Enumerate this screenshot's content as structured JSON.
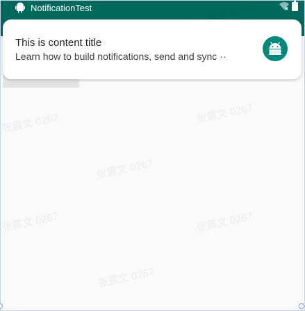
{
  "status_bar": {
    "app_label": "NotificationTest",
    "app_icon": "android-icon",
    "wifi_icon": "wifi-x-icon",
    "battery_icon": "battery-icon"
  },
  "notification": {
    "title": "This is content title",
    "text": "Learn how to build notifications, send and sync",
    "overflow_marker": "··",
    "large_icon": "android-robot-icon"
  },
  "watermark": {
    "text": "张震文 0267"
  },
  "colors": {
    "status_bar": "#00695c",
    "icon_background": "#00897b"
  }
}
